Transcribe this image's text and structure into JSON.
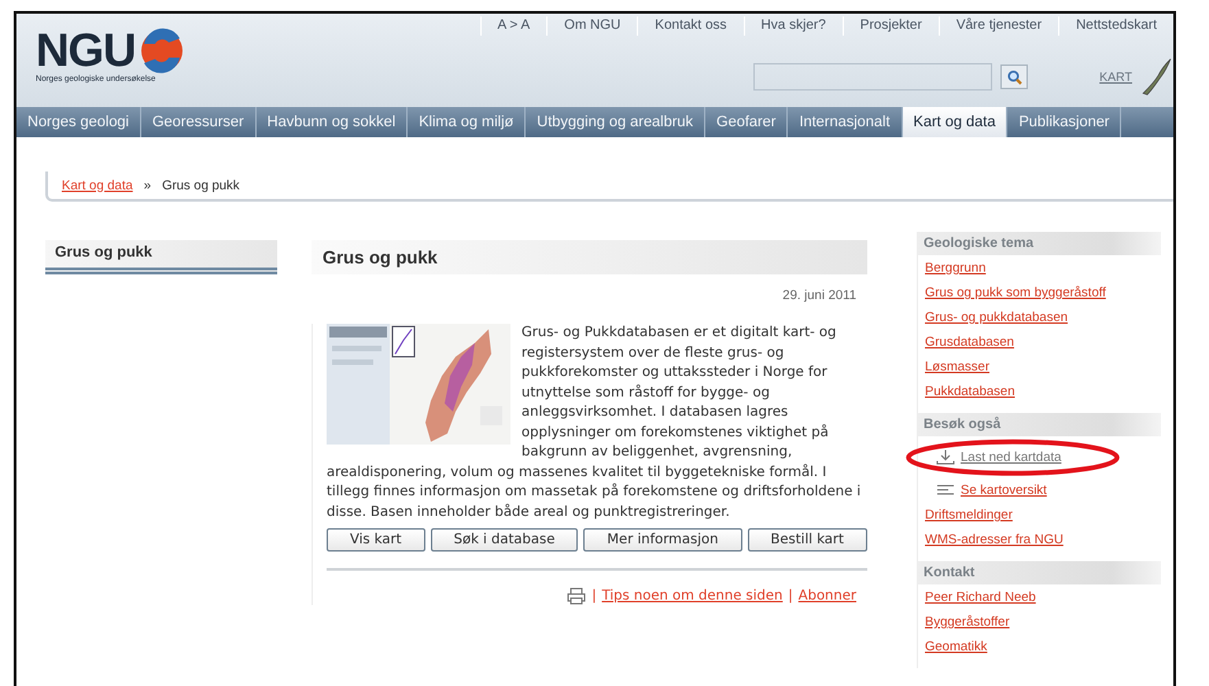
{
  "header": {
    "logo": "NGU",
    "logo_subtitle": "Norges geologiske undersøkelse",
    "top_links": [
      {
        "label": "A > A"
      },
      {
        "label": "Om NGU"
      },
      {
        "label": "Kontakt oss"
      },
      {
        "label": "Hva skjer?"
      },
      {
        "label": "Prosjekter"
      },
      {
        "label": "Våre tjenester"
      },
      {
        "label": "Nettstedskart"
      }
    ],
    "search": {
      "kind": "empty"
    },
    "map_link": "KART"
  },
  "nav": [
    {
      "label": "Norges geologi",
      "selected": false
    },
    {
      "label": "Georessurser",
      "selected": false
    },
    {
      "label": "Havbunn og sokkel",
      "selected": false
    },
    {
      "label": "Klima og miljø",
      "selected": false
    },
    {
      "label": "Utbygging og arealbruk",
      "selected": false
    },
    {
      "label": "Geofarer",
      "selected": false
    },
    {
      "label": "Internasjonalt",
      "selected": false
    },
    {
      "label": "Kart og data",
      "selected": true
    },
    {
      "label": "Publikasjoner",
      "selected": false
    }
  ],
  "breadcrumb": {
    "link": "Kart og data",
    "separator": "»",
    "current": "Grus og pukk"
  },
  "left_menu": {
    "title": "Grus og pukk"
  },
  "article": {
    "title": "Grus og pukk",
    "date": "29. juni 2011",
    "image": {
      "kind": "picture"
    },
    "text_parts": [
      "Grus- og Pukkdatabasen er et digitalt kart- og registersystem over de fleste grus- og pukkforekomster og uttakssteder i Norge for utnyttelse som råstoff for bygge- og anleggsvirksomhet. I databasen lagres opplysninger om forekomstenes viktighet på bakgrunn av beliggenhet, avgrensning,",
      "arealdisponering, volum og massenes kvalitet til byggetekniske formål. I tillegg finnes informasjon om massetak på forekomstene og driftsforholdene i disse. Basen inneholder både areal og punktregistreringer."
    ],
    "buttons": [
      "Vis kart",
      "Søk i database",
      "Mer informasjon",
      "Bestill kart"
    ],
    "footer_links": [
      {
        "sep": "|",
        "label": "Tips noen om denne siden"
      },
      {
        "sep": "|",
        "label": "Abonner"
      }
    ]
  },
  "sidebar": [
    {
      "title": "Geologiske tema",
      "links": [
        {
          "label": "Berggrunn",
          "kind": "plain"
        },
        {
          "label": "Grus og pukk som byggeråstoff",
          "kind": "plain"
        },
        {
          "label": "Grus- og pukkdatabasen",
          "kind": "plain"
        },
        {
          "label": "Grusdatabasen",
          "kind": "plain"
        },
        {
          "label": "Løsmasser",
          "kind": "plain"
        },
        {
          "label": "Pukkdatabasen",
          "kind": "plain"
        }
      ]
    },
    {
      "title": "Besøk også",
      "links": [
        {
          "label": "Last ned kartdata",
          "kind": "download"
        },
        {
          "label": "Se kartoversikt",
          "kind": "overview"
        },
        {
          "label": "Driftsmeldinger",
          "kind": "plain"
        },
        {
          "label": "WMS-adresser fra NGU",
          "kind": "plain"
        }
      ]
    },
    {
      "title": "Kontakt",
      "links": [
        {
          "label": "Peer Richard Neeb",
          "kind": "plain"
        },
        {
          "label": "Byggeråstoffer",
          "kind": "plain"
        },
        {
          "label": "Geomatikk",
          "kind": "plain"
        }
      ]
    }
  ]
}
